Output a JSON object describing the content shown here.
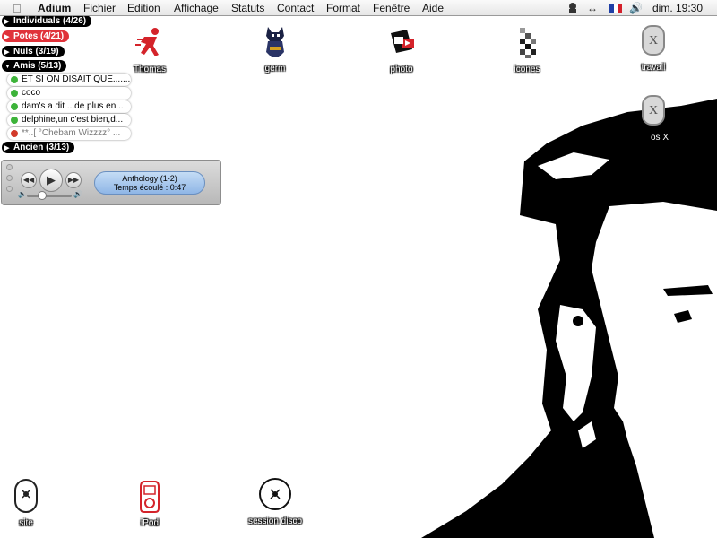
{
  "menubar": {
    "app": "Adium",
    "menus": [
      "Fichier",
      "Edition",
      "Affichage",
      "Statuts",
      "Contact",
      "Format",
      "Fenêtre",
      "Aide"
    ],
    "clock": "dim. 19:30"
  },
  "groups": {
    "individuals": "Individuals (4/26)",
    "potes": "Potes (4/21)",
    "nuls": "Nuls (3/19)",
    "amis": "Amis (5/13)",
    "ancien": "Ancien (3/13)"
  },
  "contacts": [
    {
      "name": "ET SI ON DISAIT QUE.........",
      "status": "online"
    },
    {
      "name": "coco",
      "status": "online"
    },
    {
      "name": "dam's a dit ...de plus en...",
      "status": "online"
    },
    {
      "name": "delphine,un c'est bien,d...",
      "status": "online"
    },
    {
      "name": "**..[ °Chebam Wizzzz° ...",
      "status": "away"
    }
  ],
  "player": {
    "track": "Anthology (1-2)",
    "time": "Temps écoulé : 0:47"
  },
  "desktop_icons": {
    "thomas": "Thomas",
    "germ": "germ",
    "photo": "photo",
    "icones": "icones",
    "travail": "travail",
    "osx": "os X",
    "site": "site",
    "ipod": "iPod",
    "session": "session disco"
  },
  "colors": {
    "online": "#3db33a",
    "away": "#d23a2a",
    "potes_group": "#e0323a"
  }
}
